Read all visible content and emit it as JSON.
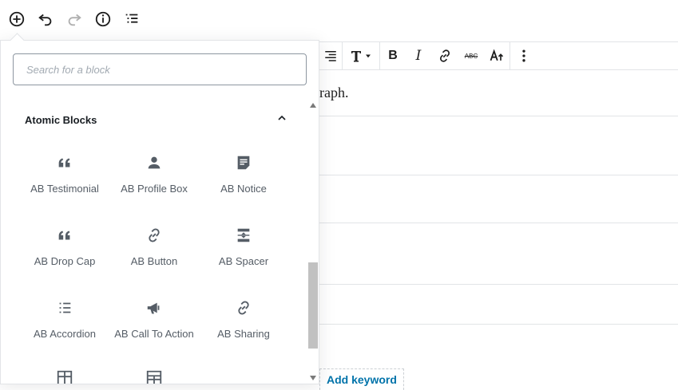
{
  "topbar": {
    "icons": [
      "add-block-icon",
      "undo-icon",
      "redo-icon",
      "info-icon",
      "outline-icon"
    ]
  },
  "inserter": {
    "search_placeholder": "Search for a block",
    "panel_title": "Atomic Blocks",
    "blocks": [
      {
        "label": "AB Testimonial",
        "icon": "quote-icon"
      },
      {
        "label": "AB Profile Box",
        "icon": "person-icon"
      },
      {
        "label": "AB Notice",
        "icon": "notice-icon"
      },
      {
        "label": "AB Drop Cap",
        "icon": "quote-icon"
      },
      {
        "label": "AB Button",
        "icon": "link-icon"
      },
      {
        "label": "AB Spacer",
        "icon": "spacer-icon"
      },
      {
        "label": "AB Accordion",
        "icon": "list-icon"
      },
      {
        "label": "AB Call To Action",
        "icon": "megaphone-icon"
      },
      {
        "label": "AB Sharing",
        "icon": "link-icon"
      }
    ]
  },
  "editor": {
    "paragraph_text": "raph.",
    "add_keyword": "Add keyword"
  },
  "colors": {
    "accent": "#0073aa",
    "icon": "#555d66",
    "border": "#e2e4e7"
  }
}
